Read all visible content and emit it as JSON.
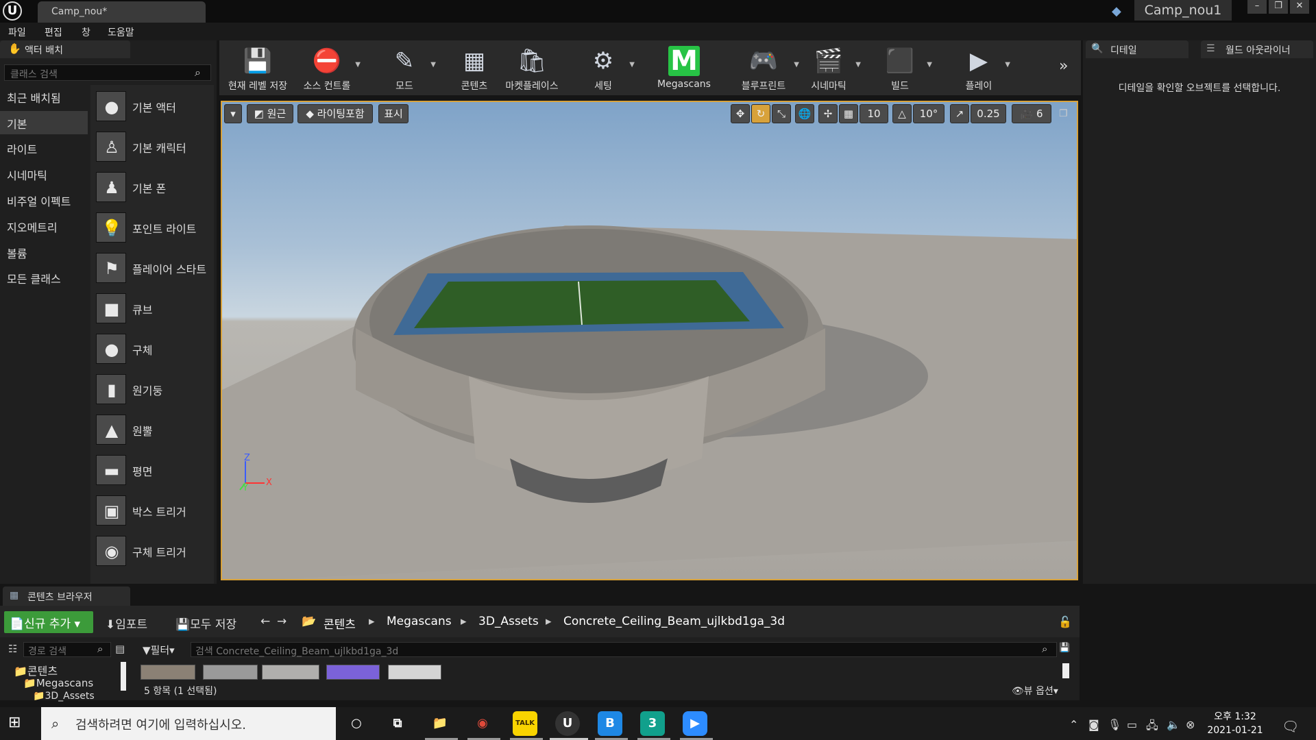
{
  "window": {
    "doc_tab": "Camp_nou*",
    "project_name": "Camp_nou1",
    "controls": [
      "–",
      "❐",
      "✕"
    ]
  },
  "menu": [
    "파일",
    "편집",
    "창",
    "도움말"
  ],
  "left_panel": {
    "title": "액터 배치",
    "search_placeholder": "클래스 검색",
    "categories": [
      "최근 배치됨",
      "기본",
      "라이트",
      "시네마틱",
      "비주얼 이펙트",
      "지오메트리",
      "볼륨",
      "모든 클래스"
    ],
    "selected_category": "기본",
    "actors": [
      "기본 액터",
      "기본 캐릭터",
      "기본 폰",
      "포인트 라이트",
      "플레이어 스타트",
      "큐브",
      "구체",
      "원기둥",
      "원뿔",
      "평면",
      "박스 트리거",
      "구체 트리거"
    ]
  },
  "toolbar": {
    "items": [
      "현재 레벨 저장",
      "소스 컨트롤",
      "모드",
      "콘텐츠",
      "마켓플레이스",
      "세팅",
      "Megascans",
      "블루프린트",
      "시네마틱",
      "빌드",
      "플레이"
    ]
  },
  "viewport": {
    "perspective_label": "원근",
    "lighting_label": "라이팅포함",
    "show_label": "표시",
    "grid_snap": "10",
    "rotation_snap": "10°",
    "scale_snap": "0.25",
    "camera_speed": "6",
    "axis_x": "X",
    "axis_y": "Y",
    "axis_z": "Z"
  },
  "right_panel": {
    "details_tab": "디테일",
    "outliner_tab": "월드 아웃라이너",
    "details_message": "디테일을 확인할 오브젝트를 선택합니다."
  },
  "content_browser": {
    "tab": "콘텐츠 브라우저",
    "add_new": "신규 추가",
    "import": "임포트",
    "save_all": "모두 저장",
    "breadcrumbs": [
      "콘텐츠",
      "Megascans",
      "3D_Assets",
      "Concrete_Ceiling_Beam_ujlkbd1ga_3d"
    ],
    "path_search_placeholder": "경로 검색",
    "filter_label": "필터",
    "asset_search_placeholder": "검색 Concrete_Ceiling_Beam_ujlkbd1ga_3d",
    "tree": [
      "콘텐츠",
      "Megascans",
      "3D_Assets"
    ],
    "item_count": "5 항목 (1 선택됨)",
    "view_options": "뷰 옵션"
  },
  "taskbar": {
    "search_placeholder": "검색하려면 여기에 입력하십시오.",
    "time": "오후 1:32",
    "date": "2021-01-21",
    "talk_label": "TALK",
    "b_label": "B",
    "three_label": "3"
  },
  "colors": {
    "accent": "#d8a23a",
    "add_new_green": "#3c9b3a",
    "megascans_green": "#27c345"
  }
}
